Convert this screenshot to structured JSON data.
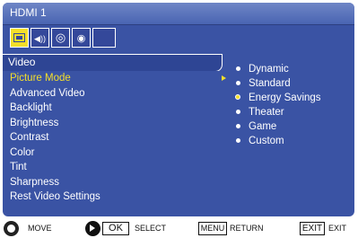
{
  "window": {
    "title": "HDMI 1"
  },
  "tabs": [
    {
      "name": "video-tab-icon",
      "active": true
    },
    {
      "name": "audio-tab-icon",
      "glyph": "◀))"
    },
    {
      "name": "setup-tab-icon",
      "glyph": "◎"
    },
    {
      "name": "parental-tab-icon",
      "glyph": "◉"
    },
    {
      "name": "empty-tab",
      "glyph": ""
    }
  ],
  "section": {
    "title": "Video"
  },
  "menu": {
    "items": [
      "Picture Mode",
      "Advanced Video",
      "Backlight",
      "Brightness",
      "Contrast",
      "Color",
      "Tint",
      "Sharpness",
      "Rest Video Settings"
    ],
    "selected_index": 0
  },
  "options": {
    "items": [
      "Dynamic",
      "Standard",
      "Energy Savings",
      "Theater",
      "Game",
      "Custom"
    ],
    "selected_index": 2
  },
  "footer": {
    "move": "MOVE",
    "ok_key": "OK",
    "select": "SELECT",
    "menu_key": "MENU",
    "return": "RETURN",
    "exit_key": "EXIT",
    "exit": "EXIT"
  },
  "colors": {
    "panel": "#3a53a4",
    "accent": "#f4df2a"
  }
}
